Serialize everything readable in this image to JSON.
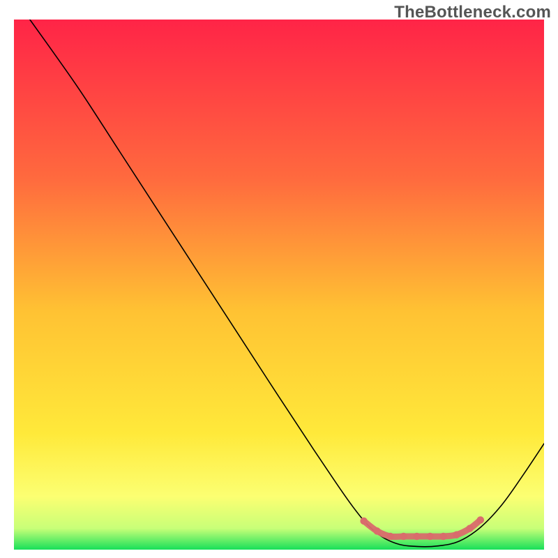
{
  "watermark": "TheBottleneck.com",
  "chart_data": {
    "type": "line",
    "title": "",
    "xlabel": "",
    "ylabel": "",
    "xlim": [
      0,
      100
    ],
    "ylim": [
      0,
      100
    ],
    "background_gradient": {
      "stops": [
        {
          "offset": 0,
          "color": "#ff2447"
        },
        {
          "offset": 30,
          "color": "#ff6a3e"
        },
        {
          "offset": 55,
          "color": "#ffc233"
        },
        {
          "offset": 78,
          "color": "#ffe93a"
        },
        {
          "offset": 90,
          "color": "#fcff72"
        },
        {
          "offset": 96,
          "color": "#c8ff78"
        },
        {
          "offset": 100,
          "color": "#18e05a"
        }
      ]
    },
    "series": [
      {
        "name": "bottleneck-curve",
        "color": "#000000",
        "width": 1.6,
        "points": [
          {
            "x": 3.0,
            "y": 100.0
          },
          {
            "x": 8.0,
            "y": 93.0
          },
          {
            "x": 13.0,
            "y": 85.8
          },
          {
            "x": 20.0,
            "y": 75.0
          },
          {
            "x": 30.0,
            "y": 59.6
          },
          {
            "x": 40.0,
            "y": 44.2
          },
          {
            "x": 50.0,
            "y": 28.8
          },
          {
            "x": 58.0,
            "y": 16.7
          },
          {
            "x": 64.0,
            "y": 8.0
          },
          {
            "x": 68.0,
            "y": 3.5
          },
          {
            "x": 72.0,
            "y": 1.2
          },
          {
            "x": 76.0,
            "y": 0.6
          },
          {
            "x": 80.0,
            "y": 0.7
          },
          {
            "x": 84.0,
            "y": 1.6
          },
          {
            "x": 88.0,
            "y": 4.2
          },
          {
            "x": 92.0,
            "y": 8.4
          },
          {
            "x": 96.0,
            "y": 14.0
          },
          {
            "x": 100.0,
            "y": 20.0
          }
        ]
      },
      {
        "name": "optimal-range-marker",
        "color": "#d96c6c",
        "width": 9,
        "points": [
          {
            "x": 66.0,
            "y": 5.4
          },
          {
            "x": 68.5,
            "y": 3.5
          },
          {
            "x": 71.0,
            "y": 2.5
          },
          {
            "x": 73.5,
            "y": 2.5
          },
          {
            "x": 76.0,
            "y": 2.5
          },
          {
            "x": 78.5,
            "y": 2.5
          },
          {
            "x": 81.0,
            "y": 2.5
          },
          {
            "x": 83.5,
            "y": 2.8
          },
          {
            "x": 86.0,
            "y": 4.0
          },
          {
            "x": 88.0,
            "y": 5.6
          }
        ]
      }
    ]
  }
}
